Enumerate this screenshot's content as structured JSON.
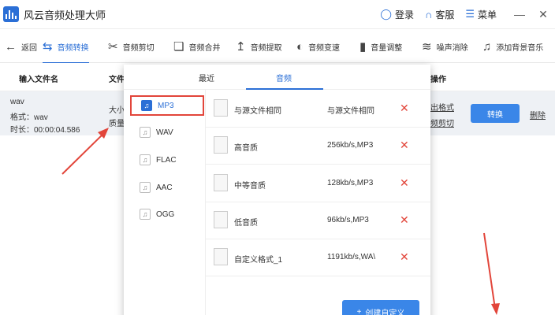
{
  "app": {
    "title": "风云音频处理大师",
    "login_label": "登录",
    "service_label": "客服",
    "menu_label": "菜单",
    "minimize_icon": "minimize-icon",
    "close_icon": "close-icon"
  },
  "toolbar": {
    "back_label": "返回",
    "items": [
      {
        "label": "音频转换",
        "icon": "convert-icon"
      },
      {
        "label": "音频剪切",
        "icon": "scissors-icon"
      },
      {
        "label": "音频合并",
        "icon": "merge-icon"
      },
      {
        "label": "音频提取",
        "icon": "extract-icon"
      },
      {
        "label": "音频变速",
        "icon": "speed-icon"
      },
      {
        "label": "音量调整",
        "icon": "volume-icon"
      },
      {
        "label": "噪声消除",
        "icon": "noise-icon"
      },
      {
        "label": "添加背景音乐",
        "icon": "music-note-icon"
      }
    ],
    "active_index": 0
  },
  "table": {
    "headers": {
      "filename": "输入文件名",
      "fileinfo": "文件",
      "action": "操作"
    }
  },
  "file": {
    "name": "wav",
    "format": "格式：wav",
    "duration": "时长：00:00:04.586",
    "size_partial": "大小",
    "quality_partial": "质量",
    "output_format_link": "出格式",
    "audio_cut_link": "频剪切",
    "convert_label": "转换",
    "delete_label": "删除"
  },
  "panel": {
    "tabs": [
      "最近",
      "音频"
    ],
    "active_tab": 1,
    "formats": [
      "MP3",
      "WAV",
      "FLAC",
      "AAC",
      "OGG"
    ],
    "selected_format": 0,
    "presets": [
      {
        "name": "与源文件相同",
        "value": "与源文件相同"
      },
      {
        "name": "高音质",
        "value": "256kb/s,MP3"
      },
      {
        "name": "中等音质",
        "value": "128kb/s,MP3"
      },
      {
        "name": "低音质",
        "value": "96kb/s,MP3"
      },
      {
        "name": "自定义格式_1",
        "value": "1191kb/s,WA\\"
      }
    ],
    "create_label": "创建自定义"
  },
  "colors": {
    "accent": "#2b6fd6",
    "button": "#3a86e8",
    "highlight_red": "#e2453a",
    "row_bg": "#eef1f5"
  }
}
